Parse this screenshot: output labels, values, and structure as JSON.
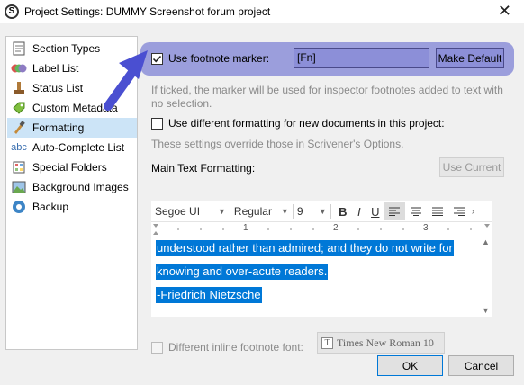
{
  "window": {
    "title": "Project Settings: DUMMY Screenshot forum project",
    "close_glyph": "✕",
    "app_glyph": "S"
  },
  "sidebar": {
    "items": [
      {
        "label": "Section Types",
        "icon": "section-types-icon",
        "selected": false
      },
      {
        "label": "Label List",
        "icon": "label-list-icon",
        "selected": false
      },
      {
        "label": "Status List",
        "icon": "status-list-icon",
        "selected": false
      },
      {
        "label": "Custom Metadata",
        "icon": "custom-metadata-icon",
        "selected": false
      },
      {
        "label": "Formatting",
        "icon": "formatting-icon",
        "selected": true
      },
      {
        "label": "Auto-Complete List",
        "icon": "auto-complete-icon",
        "selected": false
      },
      {
        "label": "Special Folders",
        "icon": "special-folders-icon",
        "selected": false
      },
      {
        "label": "Background Images",
        "icon": "background-images-icon",
        "selected": false
      },
      {
        "label": "Backup",
        "icon": "backup-icon",
        "selected": false
      }
    ]
  },
  "footnote": {
    "checkbox_label": "Use footnote marker:",
    "checked": true,
    "marker_value": "[Fn]",
    "make_default_label": "Make Default",
    "hint_line1": "If ticked, the marker will be used for inspector footnotes added to text with",
    "hint_line2": "no selection."
  },
  "doc_formatting": {
    "checkbox_label": "Use different formatting for new documents in this project:",
    "checked": false,
    "note": "These settings override those in Scrivener's Options."
  },
  "main_text": {
    "label": "Main Text Formatting:",
    "use_current_label": "Use Current"
  },
  "editor": {
    "font": "Segoe UI",
    "style": "Regular",
    "size": "9",
    "bold": "B",
    "italic": "I",
    "underline": "U",
    "ruler_marks": [
      "1",
      "2",
      "3"
    ],
    "lines": [
      "understood rather than admired; and they do not write for",
      "knowing and over-acute readers.",
      "-Friedrich Nietzsche"
    ]
  },
  "inline_footnote": {
    "checkbox_label": "Different inline footnote font:",
    "font_button_label": "Times New Roman 10",
    "enabled": false
  },
  "buttons": {
    "ok": "OK",
    "cancel": "Cancel"
  },
  "colors": {
    "highlight": "#8c8fd8",
    "selection": "#0078d7",
    "arrow": "#4a4fd1",
    "sidebar_selected": "#cce4f7"
  }
}
